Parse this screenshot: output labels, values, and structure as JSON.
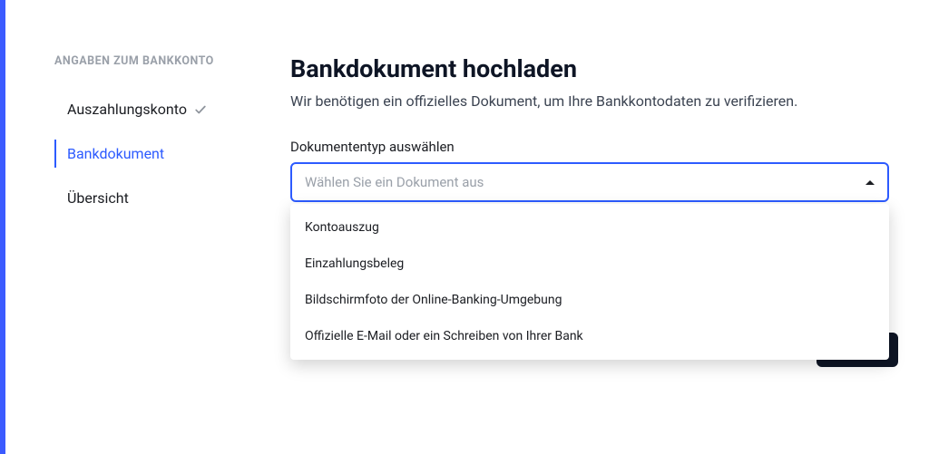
{
  "sidebar": {
    "header": "ANGABEN ZUM BANKKONTO",
    "items": [
      {
        "label": "Auszahlungskonto",
        "completed": true,
        "active": false
      },
      {
        "label": "Bankdokument",
        "completed": false,
        "active": true
      },
      {
        "label": "Übersicht",
        "completed": false,
        "active": false
      }
    ]
  },
  "main": {
    "title": "Bankdokument hochladen",
    "subtitle": "Wir benötigen ein offizielles Dokument, um Ihre Bankkontodaten zu verifizieren.",
    "select": {
      "label": "Dokumententyp auswählen",
      "placeholder": "Wählen Sie ein Dokument aus",
      "options": [
        "Kontoauszug",
        "Einzahlungsbeleg",
        "Bildschirmfoto der Online-Banking-Umgebung",
        "Offizielle E-Mail oder ein Schreiben von Ihrer Bank"
      ]
    }
  }
}
